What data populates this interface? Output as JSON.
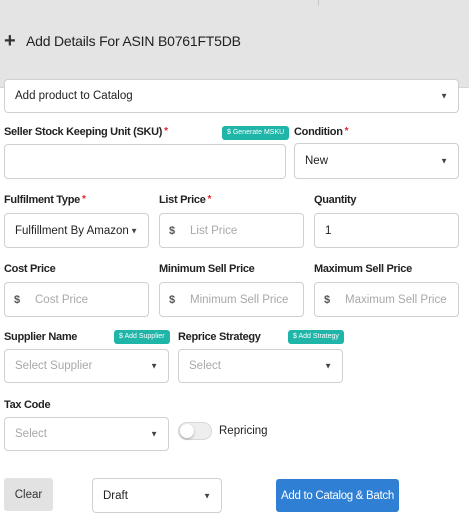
{
  "header": {
    "title": "Add Details For ASIN B0761FT5DB"
  },
  "catalog_select": {
    "value": "Add product to Catalog"
  },
  "sku": {
    "label": "Seller Stock Keeping Unit (SKU)",
    "required": "*",
    "generate_label": "$ Generate MSKU",
    "value": ""
  },
  "condition": {
    "label": "Condition",
    "required": "*",
    "value": "New"
  },
  "fulfilment": {
    "label": "Fulfilment Type",
    "required": "*",
    "value": "Fulfillment By Amazon"
  },
  "list_price": {
    "label": "List Price",
    "required": "*",
    "currency": "$",
    "placeholder": "List Price"
  },
  "quantity": {
    "label": "Quantity",
    "value": "1"
  },
  "cost_price": {
    "label": "Cost Price",
    "currency": "$",
    "placeholder": "Cost Price"
  },
  "min_sell_price": {
    "label": "Minimum Sell Price",
    "currency": "$",
    "placeholder": "Minimum Sell Price"
  },
  "max_sell_price": {
    "label": "Maximum Sell Price",
    "currency": "$",
    "placeholder": "Maximum Sell Price"
  },
  "supplier": {
    "label": "Supplier Name",
    "add_label": "$ Add Supplier",
    "placeholder": "Select Supplier"
  },
  "reprice_strategy": {
    "label": "Reprice Strategy",
    "add_label": "$ Add Strategy",
    "placeholder": "Select"
  },
  "tax_code": {
    "label": "Tax Code",
    "placeholder": "Select"
  },
  "repricing": {
    "label": "Repricing",
    "enabled": false
  },
  "footer": {
    "clear_label": "Clear",
    "status_value": "Draft",
    "submit_label": "Add to Catalog & Batch"
  },
  "icons": {
    "caret": "▼",
    "plus": "+"
  },
  "colors": {
    "accent_teal": "#1fb5a8",
    "primary_blue": "#2f7fd4",
    "required_red": "#e0242a"
  }
}
